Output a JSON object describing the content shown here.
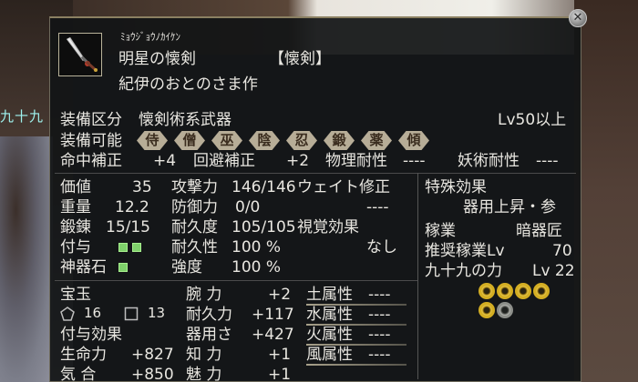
{
  "background": {
    "side_name": "九十九"
  },
  "window": {
    "close_glyph": "✕"
  },
  "item": {
    "furigana": "ﾐｮｳｼﾞｮｳﾉｶｲｹﾝ",
    "name": "明星の懐剣",
    "category": "【懐剣】",
    "maker": "紀伊のおとのさま作"
  },
  "equip": {
    "class_label": "装備区分",
    "class_value": "懐剣術系武器",
    "level_req": "Lv50以上",
    "allowed_label": "装備可能",
    "allowed": [
      "侍",
      "僧",
      "巫",
      "陰",
      "忍",
      "鍛",
      "薬",
      "傾"
    ]
  },
  "hit_row": {
    "hit_label": "命中補正",
    "hit_value": "+4",
    "evade_label": "回避補正",
    "evade_value": "+2",
    "phys_label": "物理耐性",
    "phys_value": "----",
    "magic_label": "妖術耐性",
    "magic_value": "----"
  },
  "stats": {
    "price_label": "価値",
    "price_value": "35",
    "weight_label": "重量",
    "weight_value": "12.2",
    "forge_label": "鍛錬",
    "forge_value": "15/15",
    "attach_label": "付与",
    "relic_label": "神器石",
    "atk_label": "攻撃力",
    "atk_value": "146/146",
    "def_label": "防御力",
    "def_value": "0/0",
    "dur_label": "耐久度",
    "dur_value": "105/105",
    "durprop_label": "耐久性",
    "durprop_value": "100 %",
    "str_label": "強度",
    "str_value": "100 %",
    "weight_mod_label": "ウェイト修正",
    "weight_mod_value": "----",
    "visual_label": "視覚効果",
    "visual_value": "なし"
  },
  "special": {
    "title": "特殊効果",
    "effect": "器用上昇・参",
    "job_label": "稼業",
    "job_value": "暗器匠",
    "rec_label": "推奨稼業Lv",
    "rec_value": "70",
    "power_label": "九十九の力",
    "power_value": "Lv 22",
    "rings_filled": 5,
    "rings_total": 6
  },
  "gems": {
    "title": "宝玉",
    "pentagon_value": "16",
    "square_value": "13",
    "effects_label": "付与効果"
  },
  "bonus": {
    "hp_label": "生命力",
    "hp_value": "+827",
    "ki_label": "気 合",
    "ki_value": "+850",
    "arm_label": "腕 力",
    "arm_value": "+2",
    "int_label": "知 力",
    "int_value": "+1",
    "end_label": "耐久力",
    "end_value": "+117",
    "cha_label": "魅 力",
    "cha_value": "+1",
    "dex_label": "器用さ",
    "dex_value": "+427"
  },
  "elements": {
    "earth_label": "土属性",
    "earth_value": "----",
    "water_label": "水属性",
    "water_value": "----",
    "fire_label": "火属性",
    "fire_value": "----",
    "wind_label": "風属性",
    "wind_value": "----"
  }
}
